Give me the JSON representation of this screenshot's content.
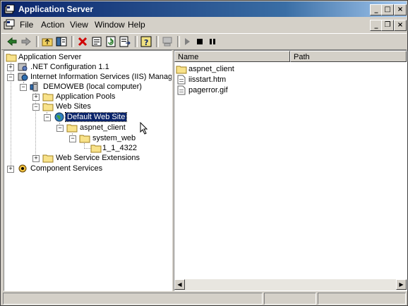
{
  "window": {
    "title": "Application Server",
    "controls": {
      "minimize": "_",
      "maximize": "□",
      "close": "×"
    }
  },
  "menubar": {
    "items": [
      "File",
      "Action",
      "View",
      "Window",
      "Help"
    ],
    "mdi_controls": {
      "minimize": "_",
      "restore": "❐",
      "close": "×"
    }
  },
  "toolbar": {
    "buttons": [
      "back-icon",
      "forward-icon",
      "up-folder-icon",
      "show-hide-tree-icon",
      "delete-icon",
      "properties-icon",
      "refresh-icon",
      "export-list-icon",
      "help-icon",
      "computer-icon",
      "start-icon",
      "stop-icon",
      "pause-icon"
    ]
  },
  "tree": {
    "root": "Application Server",
    "net_config": ".NET Configuration 1.1",
    "iis_manager": "Internet Information Services (IIS) Manager",
    "demoweb": "DEMOWEB (local computer)",
    "app_pools": "Application Pools",
    "web_sites": "Web Sites",
    "default_site": "Default Web Site",
    "aspnet_client": "aspnet_client",
    "system_web": "system_web",
    "version": "1_1_4322",
    "web_service_ext": "Web Service Extensions",
    "component_services": "Component Services"
  },
  "list": {
    "columns": [
      "Name",
      "Path"
    ],
    "rows": [
      {
        "name": "aspnet_client",
        "icon": "folder-icon"
      },
      {
        "name": "iisstart.htm",
        "icon": "document-icon"
      },
      {
        "name": "pagerror.gif",
        "icon": "document-icon"
      }
    ]
  },
  "colors": {
    "titlebar": "#0a246a",
    "selection": "#0a246a",
    "chrome": "#d4d0c8"
  }
}
